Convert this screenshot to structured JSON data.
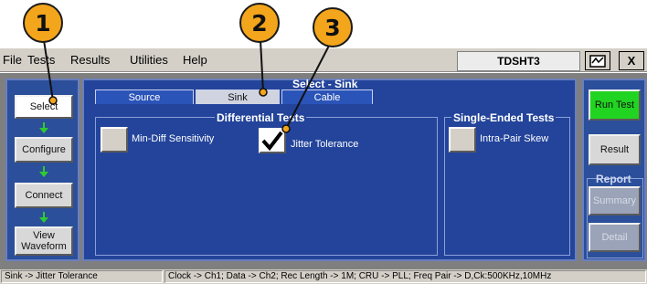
{
  "callouts": [
    "1",
    "2",
    "3"
  ],
  "menu": [
    "File",
    "Tests",
    "Results",
    "Utilities",
    "Help"
  ],
  "app_title": "TDSHT3",
  "window_buttons": {
    "minimize_icon": "window-icon",
    "close": "X"
  },
  "nav": {
    "select": "Select",
    "configure": "Configure",
    "connect": "Connect",
    "view_waveform": "View Waveform"
  },
  "panel_title": "Select - Sink",
  "tabs": [
    "Source",
    "Sink",
    "Cable"
  ],
  "active_tab": "Sink",
  "differential": {
    "title": "Differential Tests",
    "items": [
      {
        "label": "Min-Diff Sensitivity",
        "checked": false
      },
      {
        "label": "Jitter Tolerance",
        "checked": true
      }
    ]
  },
  "single_ended": {
    "title": "Single-Ended Tests",
    "items": [
      {
        "label": "Intra-Pair Skew",
        "checked": false
      }
    ]
  },
  "right_panel": {
    "run_test": "Run Test",
    "result": "Result",
    "report_title": "Report",
    "summary": "Summary",
    "detail": "Detail"
  },
  "status": {
    "left": "Sink -> Jitter Tolerance",
    "right": "Clock -> Ch1; Data -> Ch2; Rec Length -> 1M; CRU -> PLL; Freq Pair -> D,Ck:500KHz,10MHz"
  },
  "colors": {
    "callout": "#f3a51c",
    "panel_blue": "#23449a",
    "run_green": "#22d422"
  }
}
